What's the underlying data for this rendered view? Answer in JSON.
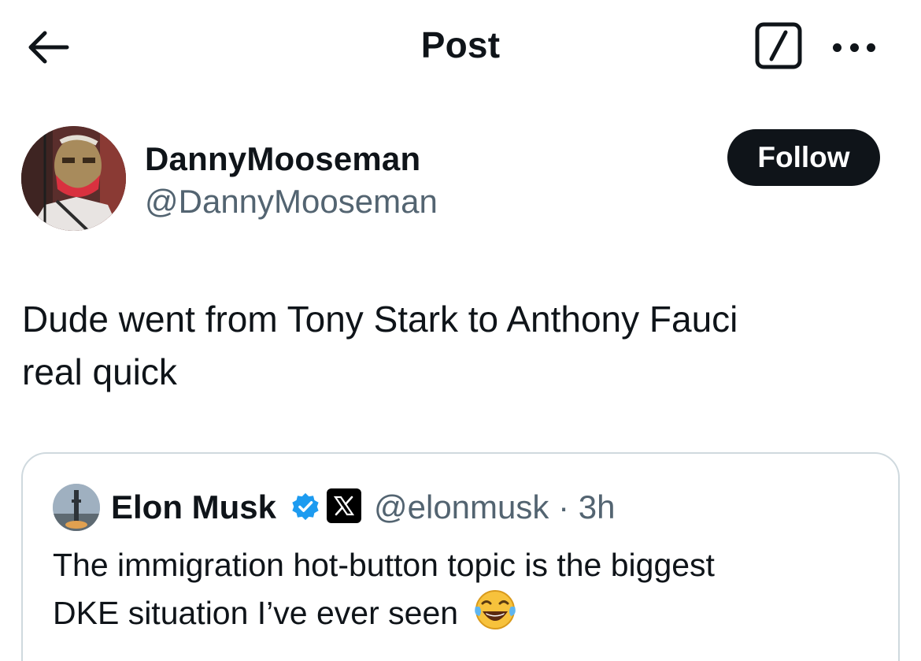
{
  "header": {
    "title": "Post",
    "back_icon": "arrow-left-icon",
    "grok_icon": "grok-slash-icon",
    "more_icon": "ellipsis-icon"
  },
  "author": {
    "display_name": "DannyMooseman",
    "handle": "@DannyMooseman",
    "follow_label": "Follow"
  },
  "post": {
    "line1": "Dude went from Tony Stark to Anthony Fauci",
    "line2": "real quick"
  },
  "quoted": {
    "name": "Elon Musk",
    "handle": "@elonmusk",
    "separator": "·",
    "time": "3h",
    "line1": "The immigration hot-button topic is the biggest",
    "line2": "DKE situation I’ve ever seen",
    "emoji_icon": "face-with-tears-of-joy-icon",
    "verified_color": "#1d9bf0"
  },
  "colors": {
    "text_primary": "#0f1419",
    "text_secondary": "#536471",
    "border": "#cfd9de"
  }
}
